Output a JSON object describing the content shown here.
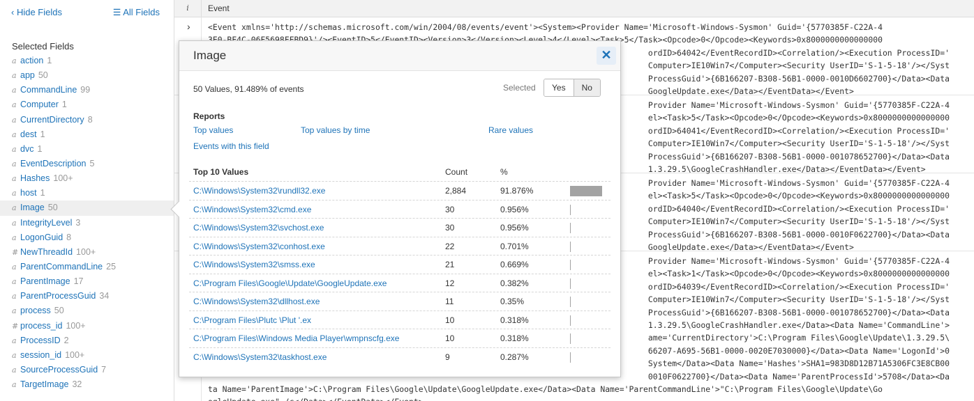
{
  "sidebar": {
    "hide_fields": "Hide Fields",
    "all_fields": "All Fields",
    "selected_title": "Selected Fields",
    "fields": [
      {
        "type": "a",
        "name": "action",
        "count": "1"
      },
      {
        "type": "a",
        "name": "app",
        "count": "50"
      },
      {
        "type": "a",
        "name": "CommandLine",
        "count": "99"
      },
      {
        "type": "a",
        "name": "Computer",
        "count": "1"
      },
      {
        "type": "a",
        "name": "CurrentDirectory",
        "count": "8"
      },
      {
        "type": "a",
        "name": "dest",
        "count": "1"
      },
      {
        "type": "a",
        "name": "dvc",
        "count": "1"
      },
      {
        "type": "a",
        "name": "EventDescription",
        "count": "5"
      },
      {
        "type": "a",
        "name": "Hashes",
        "count": "100+"
      },
      {
        "type": "a",
        "name": "host",
        "count": "1"
      },
      {
        "type": "a",
        "name": "Image",
        "count": "50"
      },
      {
        "type": "a",
        "name": "IntegrityLevel",
        "count": "3"
      },
      {
        "type": "a",
        "name": "LogonGuid",
        "count": "8"
      },
      {
        "type": "#",
        "name": "NewThreadId",
        "count": "100+"
      },
      {
        "type": "a",
        "name": "ParentCommandLine",
        "count": "25"
      },
      {
        "type": "a",
        "name": "ParentImage",
        "count": "17"
      },
      {
        "type": "a",
        "name": "ParentProcessGuid",
        "count": "34"
      },
      {
        "type": "a",
        "name": "process",
        "count": "50"
      },
      {
        "type": "#",
        "name": "process_id",
        "count": "100+"
      },
      {
        "type": "a",
        "name": "ProcessID",
        "count": "2"
      },
      {
        "type": "a",
        "name": "session_id",
        "count": "100+"
      },
      {
        "type": "a",
        "name": "SourceProcessGuid",
        "count": "7"
      },
      {
        "type": "a",
        "name": "TargetImage",
        "count": "32"
      }
    ],
    "active_field": "Image"
  },
  "events": {
    "col_i": "i",
    "col_event": "Event",
    "rows": [
      {
        "text": "<Event xmlns='http://schemas.microsoft.com/win/2004/08/events/event'><System><Provider Name='Microsoft-Windows-Sysmon' Guid='{5770385F-C22A-4\n3E0-BF4C-06F5698FFBD9}'/><EventID>5</EventID><Version>3</Version><Level>4</Level><Task>5</Task><Opcode>0</Opcode><Keywords>0x8000000000000000\n                                                                                            ordID>64042</EventRecordID><Correlation/><Execution ProcessID='\n                                                                                            Computer>IE10Win7</Computer><Security UserID='S-1-5-18'/></Syst\n                                                                                            ProcessGuid'>{6B166207-B308-56B1-0000-0010D6602700}</Data><Data\n                                                                                            GoogleUpdate.exe</Data></EventData></Event>"
      },
      {
        "text": "                                                                                            Provider Name='Microsoft-Windows-Sysmon' Guid='{5770385F-C22A-4\n                                                                                            el><Task>5</Task><Opcode>0</Opcode><Keywords>0x8000000000000000\n                                                                                            ordID>64041</EventRecordID><Correlation/><Execution ProcessID='\n                                                                                            Computer>IE10Win7</Computer><Security UserID='S-1-5-18'/></Syst\n                                                                                            ProcessGuid'>{6B166207-B308-56B1-0000-001078652700}</Data><Data\n                                                                                            1.3.29.5\\GoogleCrashHandler.exe</Data></EventData></Event>"
      },
      {
        "text": "                                                                                            Provider Name='Microsoft-Windows-Sysmon' Guid='{5770385F-C22A-4\n                                                                                            el><Task>5</Task><Opcode>0</Opcode><Keywords>0x8000000000000000\n                                                                                            ordID>64040</EventRecordID><Correlation/><Execution ProcessID='\n                                                                                            Computer>IE10Win7</Computer><Security UserID='S-1-5-18'/></Syst\n                                                                                            ProcessGuid'>{6B166207-B308-56B1-0000-0010F0622700}</Data><Data\n                                                                                            GoogleUpdate.exe</Data></EventData></Event>"
      },
      {
        "text": "                                                                                            Provider Name='Microsoft-Windows-Sysmon' Guid='{5770385F-C22A-4\n                                                                                            el><Task>1</Task><Opcode>0</Opcode><Keywords>0x8000000000000000\n                                                                                            ordID>64039</EventRecordID><Correlation/><Execution ProcessID='\n                                                                                            Computer>IE10Win7</Computer><Security UserID='S-1-5-18'/></Syst\n                                                                                            ProcessGuid'>{6B166207-B308-56B1-0000-001078652700}</Data><Data\n                                                                                            1.3.29.5\\GoogleCrashHandler.exe</Data><Data Name='CommandLine'>\n                                                                                            ame='CurrentDirectory'>C:\\Program Files\\Google\\Update\\1.3.29.5\\\n                                                                                            66207-A695-56B1-0000-0020E7030000}</Data><Data Name='LogonId'>0\n                                                                                            System</Data><Data Name='Hashes'>SHA1=983D8D12B71A5306FC3E8CB00\n                                                                                            0010F0622700}</Data><Data Name='ParentProcessId'>5708</Data><Da\nta Name='ParentImage'>C:\\Program Files\\Google\\Update\\GoogleUpdate.exe</Data><Data Name='ParentCommandLine'>\"C:\\Program Files\\Google\\Update\\Go\nogleUpdate.exe\" /c</Data></EventData></Event>"
      }
    ]
  },
  "popover": {
    "title": "Image",
    "close_glyph": "✕",
    "summary": "50 Values, 91.489% of events",
    "selected_label": "Selected",
    "yes_label": "Yes",
    "no_label": "No",
    "reports_title": "Reports",
    "links": {
      "top_values": "Top values",
      "top_values_by_time": "Top values by time",
      "rare_values": "Rare values",
      "events_with_field": "Events with this field"
    },
    "table_title": "Top 10 Values",
    "col_count": "Count",
    "col_pct": "%",
    "rows": [
      {
        "value": "C:\\Windows\\System32\\rundll32.exe",
        "count": "2,884",
        "pct": "91.876%",
        "fraction": 0.91876
      },
      {
        "value": "C:\\Windows\\System32\\cmd.exe",
        "count": "30",
        "pct": "0.956%",
        "fraction": 0.00956
      },
      {
        "value": "C:\\Windows\\System32\\svchost.exe",
        "count": "30",
        "pct": "0.956%",
        "fraction": 0.00956
      },
      {
        "value": "C:\\Windows\\System32\\conhost.exe",
        "count": "22",
        "pct": "0.701%",
        "fraction": 0.00701
      },
      {
        "value": "C:\\Windows\\System32\\smss.exe",
        "count": "21",
        "pct": "0.669%",
        "fraction": 0.00669
      },
      {
        "value": "C:\\Program Files\\Google\\Update\\GoogleUpdate.exe",
        "count": "12",
        "pct": "0.382%",
        "fraction": 0.00382
      },
      {
        "value": "C:\\Windows\\System32\\dllhost.exe",
        "count": "11",
        "pct": "0.35%",
        "fraction": 0.0035
      },
      {
        "value": "C:\\Program Files\\Plutc       \\Plut     '.ex",
        "count": "10",
        "pct": "0.318%",
        "fraction": 0.00318
      },
      {
        "value": "C:\\Program Files\\Windows Media Player\\wmpnscfg.exe",
        "count": "10",
        "pct": "0.318%",
        "fraction": 0.00318
      },
      {
        "value": "C:\\Windows\\System32\\taskhost.exe",
        "count": "9",
        "pct": "0.287%",
        "fraction": 0.00287
      }
    ]
  }
}
